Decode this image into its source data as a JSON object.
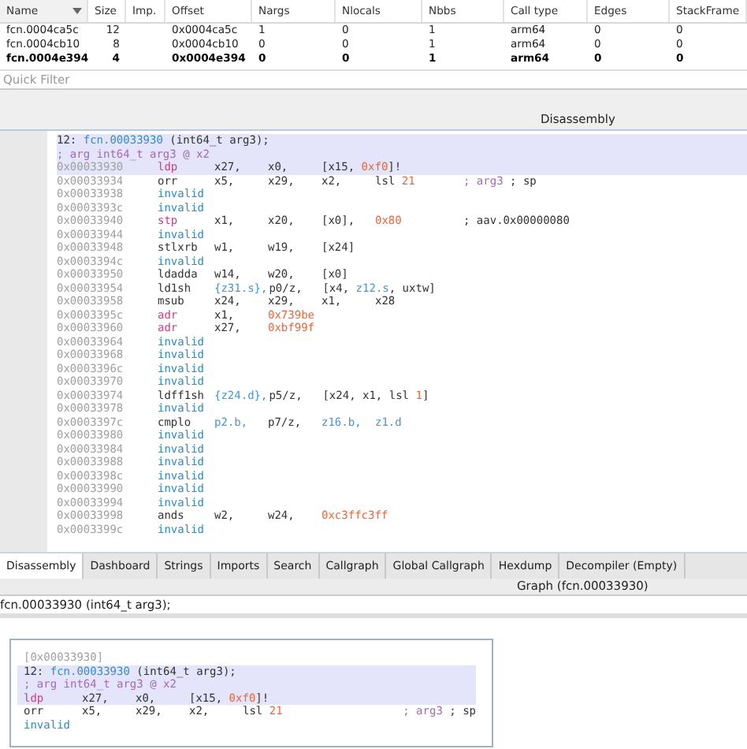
{
  "table": {
    "columns": [
      {
        "label": "Name",
        "sorted": true
      },
      {
        "label": "Size",
        "sorted": false
      },
      {
        "label": "Imp.",
        "sorted": false
      },
      {
        "label": "Offset",
        "sorted": false
      },
      {
        "label": "Nargs",
        "sorted": false
      },
      {
        "label": "Nlocals",
        "sorted": false
      },
      {
        "label": "Nbbs",
        "sorted": false
      },
      {
        "label": "Call type",
        "sorted": false
      },
      {
        "label": "Edges",
        "sorted": false
      },
      {
        "label": "StackFrame",
        "sorted": false
      }
    ],
    "rows": [
      {
        "name": "fcn.0004ca5c",
        "size": "12",
        "offset": "0x0004ca5c",
        "nargs": "1",
        "nlocals": "0",
        "nbbs": "1",
        "call_type": "arm64",
        "edges": "0",
        "stackframe": "0",
        "selected": false
      },
      {
        "name": "fcn.0004cb10",
        "size": "8",
        "offset": "0x0004cb10",
        "nargs": "0",
        "nlocals": "0",
        "nbbs": "1",
        "call_type": "arm64",
        "edges": "0",
        "stackframe": "0",
        "selected": false
      },
      {
        "name": "fcn.0004e394",
        "size": "4",
        "offset": "0x0004e394",
        "nargs": "0",
        "nlocals": "0",
        "nbbs": "1",
        "call_type": "arm64",
        "edges": "0",
        "stackframe": "0",
        "selected": true
      }
    ]
  },
  "quick_filter": {
    "placeholder": "Quick Filter"
  },
  "dock_title": "Disassembly",
  "disassembly": {
    "header": {
      "index": "12:",
      "func": "fcn.00033930",
      "signature": "(int64_t arg3);"
    },
    "arg_comment": "; arg int64_t arg3 @ x2",
    "lines": [
      {
        "addr": "0x00033930",
        "mnemonic": "ldp",
        "kind": "stack",
        "selected": true,
        "ops": [
          {
            "text": "x27,",
            "kind": "reg"
          },
          {
            "text": "x0,",
            "kind": "reg"
          },
          {
            "kind": "mixed",
            "parts": [
              {
                "text": "[x15, ",
                "kind": "reg"
              },
              {
                "text": "0xf0",
                "kind": "num"
              },
              {
                "text": "]!",
                "kind": "reg"
              }
            ]
          }
        ]
      },
      {
        "addr": "0x00033934",
        "mnemonic": "orr",
        "kind": "plain",
        "selected": false,
        "ops": [
          {
            "text": "x5,",
            "kind": "reg"
          },
          {
            "text": "x29,",
            "kind": "reg"
          },
          {
            "text": "x2,",
            "kind": "reg"
          },
          {
            "kind": "mixed",
            "parts": [
              {
                "text": "lsl ",
                "kind": "reg"
              },
              {
                "text": "21",
                "kind": "num"
              }
            ]
          }
        ],
        "comment": [
          {
            "text": "; arg3",
            "kind": "arg"
          },
          {
            "text": " ; sp",
            "kind": "plain"
          }
        ]
      },
      {
        "addr": "0x00033938",
        "mnemonic": "invalid",
        "kind": "invalid",
        "selected": false
      },
      {
        "addr": "0x0003393c",
        "mnemonic": "invalid",
        "kind": "invalid",
        "selected": false
      },
      {
        "addr": "0x00033940",
        "mnemonic": "stp",
        "kind": "stack",
        "selected": false,
        "ops": [
          {
            "text": "x1,",
            "kind": "reg"
          },
          {
            "text": "x20,",
            "kind": "reg"
          },
          {
            "text": "[x0],",
            "kind": "reg"
          },
          {
            "text": "0x80",
            "kind": "num"
          }
        ],
        "comment": [
          {
            "text": "; aav.0x00000080",
            "kind": "plain"
          }
        ]
      },
      {
        "addr": "0x00033944",
        "mnemonic": "invalid",
        "kind": "invalid",
        "selected": false
      },
      {
        "addr": "0x00033948",
        "mnemonic": "stlxrb",
        "kind": "plain",
        "selected": false,
        "ops": [
          {
            "text": "w1,",
            "kind": "reg"
          },
          {
            "text": "w19,",
            "kind": "reg"
          },
          {
            "text": "[x24]",
            "kind": "reg"
          }
        ]
      },
      {
        "addr": "0x0003394c",
        "mnemonic": "invalid",
        "kind": "invalid",
        "selected": false
      },
      {
        "addr": "0x00033950",
        "mnemonic": "ldadda",
        "kind": "plain",
        "selected": false,
        "ops": [
          {
            "text": "w14,",
            "kind": "reg"
          },
          {
            "text": "w20,",
            "kind": "reg"
          },
          {
            "text": "[x0]",
            "kind": "reg"
          }
        ]
      },
      {
        "addr": "0x00033954",
        "mnemonic": "ld1sh",
        "kind": "plain",
        "selected": false,
        "ops": [
          {
            "text": "{z31.s},",
            "kind": "vec"
          },
          {
            "text": "p0/z,",
            "kind": "reg"
          },
          {
            "kind": "mixed",
            "parts": [
              {
                "text": "[x4, ",
                "kind": "reg"
              },
              {
                "text": "z12.s",
                "kind": "vec"
              },
              {
                "text": ", uxtw]",
                "kind": "reg"
              }
            ]
          }
        ]
      },
      {
        "addr": "0x00033958",
        "mnemonic": "msub",
        "kind": "plain",
        "selected": false,
        "ops": [
          {
            "text": "x24,",
            "kind": "reg"
          },
          {
            "text": "x29,",
            "kind": "reg"
          },
          {
            "text": "x1,",
            "kind": "reg"
          },
          {
            "text": "x28",
            "kind": "reg"
          }
        ]
      },
      {
        "addr": "0x0003395c",
        "mnemonic": "adr",
        "kind": "addr",
        "selected": false,
        "ops": [
          {
            "text": "x1,",
            "kind": "reg"
          },
          {
            "text": "0x739be",
            "kind": "num"
          }
        ]
      },
      {
        "addr": "0x00033960",
        "mnemonic": "adr",
        "kind": "addr",
        "selected": false,
        "ops": [
          {
            "text": "x27,",
            "kind": "reg"
          },
          {
            "text": "0xbf99f",
            "kind": "num"
          }
        ]
      },
      {
        "addr": "0x00033964",
        "mnemonic": "invalid",
        "kind": "invalid",
        "selected": false
      },
      {
        "addr": "0x00033968",
        "mnemonic": "invalid",
        "kind": "invalid",
        "selected": false
      },
      {
        "addr": "0x0003396c",
        "mnemonic": "invalid",
        "kind": "invalid",
        "selected": false
      },
      {
        "addr": "0x00033970",
        "mnemonic": "invalid",
        "kind": "invalid",
        "selected": false
      },
      {
        "addr": "0x00033974",
        "mnemonic": "ldff1sh",
        "kind": "plain",
        "selected": false,
        "ops": [
          {
            "text": "{z24.d},",
            "kind": "vec"
          },
          {
            "text": "p5/z,",
            "kind": "reg"
          },
          {
            "kind": "mixed",
            "parts": [
              {
                "text": "[x24, x1, lsl ",
                "kind": "reg"
              },
              {
                "text": "1",
                "kind": "num"
              },
              {
                "text": "]",
                "kind": "reg"
              }
            ]
          }
        ]
      },
      {
        "addr": "0x00033978",
        "mnemonic": "invalid",
        "kind": "invalid",
        "selected": false
      },
      {
        "addr": "0x0003397c",
        "mnemonic": "cmplo",
        "kind": "plain",
        "selected": false,
        "ops": [
          {
            "text": "p2.b,",
            "kind": "vec"
          },
          {
            "text": "p7/z,",
            "kind": "reg"
          },
          {
            "text": "z16.b,",
            "kind": "vec"
          },
          {
            "text": "z1.d",
            "kind": "vec"
          }
        ]
      },
      {
        "addr": "0x00033980",
        "mnemonic": "invalid",
        "kind": "invalid",
        "selected": false
      },
      {
        "addr": "0x00033984",
        "mnemonic": "invalid",
        "kind": "invalid",
        "selected": false
      },
      {
        "addr": "0x00033988",
        "mnemonic": "invalid",
        "kind": "invalid",
        "selected": false
      },
      {
        "addr": "0x0003398c",
        "mnemonic": "invalid",
        "kind": "invalid",
        "selected": false
      },
      {
        "addr": "0x00033990",
        "mnemonic": "invalid",
        "kind": "invalid",
        "selected": false
      },
      {
        "addr": "0x00033994",
        "mnemonic": "invalid",
        "kind": "invalid",
        "selected": false
      },
      {
        "addr": "0x00033998",
        "mnemonic": "ands",
        "kind": "plain",
        "selected": false,
        "ops": [
          {
            "text": "w2,",
            "kind": "reg"
          },
          {
            "text": "w24,",
            "kind": "reg"
          },
          {
            "text": "0xc3ffc3ff",
            "kind": "num"
          }
        ]
      },
      {
        "addr": "0x0003399c",
        "mnemonic": "invalid",
        "kind": "invalid",
        "selected": false
      }
    ]
  },
  "tabs": [
    {
      "label": "Disassembly",
      "selected": true
    },
    {
      "label": "Dashboard",
      "selected": false
    },
    {
      "label": "Strings",
      "selected": false
    },
    {
      "label": "Imports",
      "selected": false
    },
    {
      "label": "Search",
      "selected": false
    },
    {
      "label": "Callgraph",
      "selected": false
    },
    {
      "label": "Global Callgraph",
      "selected": false
    },
    {
      "label": "Hexdump",
      "selected": false
    },
    {
      "label": "Decompiler (Empty)",
      "selected": false
    }
  ],
  "graph": {
    "title": "Graph (fcn.00033930)",
    "signature": "fcn.00033930 (int64_t arg3);",
    "node": {
      "address": "[0x00033930]",
      "header": {
        "index": "12:",
        "func": "fcn.00033930",
        "signature": "(int64_t arg3);"
      },
      "arg_comment": "; arg int64_t arg3 @ x2",
      "lines": [
        {
          "mnemonic": "ldp",
          "kind": "stack",
          "selected": true,
          "ops": [
            {
              "text": "x27,",
              "kind": "reg"
            },
            {
              "text": "x0,",
              "kind": "reg"
            },
            {
              "kind": "mixed",
              "parts": [
                {
                  "text": "[x15, ",
                  "kind": "reg"
                },
                {
                  "text": "0xf0",
                  "kind": "num"
                },
                {
                  "text": "]!",
                  "kind": "reg"
                }
              ]
            }
          ]
        },
        {
          "mnemonic": "orr",
          "kind": "plain",
          "selected": false,
          "ops": [
            {
              "text": "x5,",
              "kind": "reg"
            },
            {
              "text": "x29,",
              "kind": "reg"
            },
            {
              "text": "x2,",
              "kind": "reg"
            },
            {
              "kind": "mixed",
              "parts": [
                {
                  "text": "lsl ",
                  "kind": "reg"
                },
                {
                  "text": "21",
                  "kind": "num"
                }
              ]
            }
          ],
          "comment": [
            {
              "text": "; arg3",
              "kind": "arg"
            },
            {
              "text": " ; sp",
              "kind": "plain"
            }
          ]
        },
        {
          "mnemonic": "invalid",
          "kind": "invalid",
          "selected": false
        }
      ]
    }
  }
}
